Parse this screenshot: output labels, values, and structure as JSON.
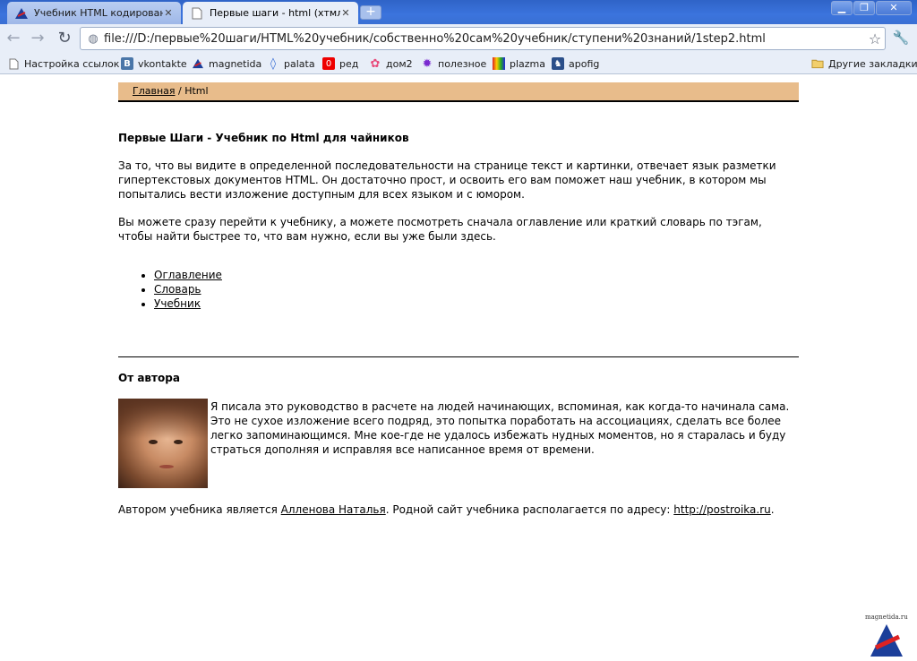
{
  "browser": {
    "tabs": [
      {
        "title": "Учебник HTML кодирован...",
        "active": false,
        "icon": "site-a-icon"
      },
      {
        "title": "Первые шаги - html (хтмл...",
        "active": true,
        "icon": "document-icon"
      }
    ],
    "address": "file:///D:/первые%20шаги/HTML%20учебник/собственно%20сам%20учебник/ступени%20знаний/1step2.html",
    "bookmarks": [
      {
        "label": "Настройка ссылок",
        "icon": "page-icon"
      },
      {
        "label": "vkontakte",
        "icon": "vk-icon"
      },
      {
        "label": "magnetida",
        "icon": "site-a-icon"
      },
      {
        "label": "palata",
        "icon": "drop-icon"
      },
      {
        "label": "ред",
        "icon": "red-icon"
      },
      {
        "label": "дом2",
        "icon": "flower-icon"
      },
      {
        "label": "полезное",
        "icon": "burst-icon"
      },
      {
        "label": "plazma",
        "icon": "plazma-icon"
      },
      {
        "label": "apofig",
        "icon": "apofig-icon"
      }
    ],
    "other_bookmarks": "Другие закладки",
    "colors": {
      "chrome": "#e8eef8",
      "titlebar": "#3b74dd"
    }
  },
  "page": {
    "breadcrumb": {
      "home": "Главная",
      "separator": " / ",
      "current": "Html"
    },
    "colors": {
      "breadcrumb_bg": "#e8bc8b"
    },
    "title": "Первые Шаги - Учебник по Html для чайников",
    "para1": "За то, что вы видите в определенной последовательности на странице текст и картинки, отвечает язык разметки гипертекстовых документов HTML. Он достаточно прост, и освоить его вам поможет наш учебник, в котором мы попытались вести изложение доступным для всех языком и с юмором.",
    "para2": "Вы можете сразу перейти к учебнику, а можете посмотреть сначала оглавление или краткий словарь по тэгам, чтобы найти быстрее то, что вам нужно, если вы уже были здесь.",
    "links": [
      "Оглавление",
      "Словарь",
      "Учебник"
    ],
    "author_heading": "От автора",
    "author_text": "Я писала это руководство в расчете на людей начинающих, вспоминая, как когда-то начинала сама. Это не сухое изложение всего подряд, это попытка поработать на ассоциациях, сделать все более легко запоминающимся. Мне кое-где не удалось избежать нудных моментов, но я старалась и буду страться дополняя и исправляя все написанное время от времени.",
    "footer": {
      "prefix": "Автором учебника является ",
      "author_link": "Алленова Наталья",
      "middle": ". Родной сайт учебника располагается по адресу: ",
      "site_link": "http://postroika.ru",
      "suffix": "."
    },
    "watermark": "magnetida.ru"
  }
}
